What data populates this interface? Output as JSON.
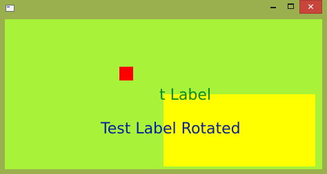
{
  "window": {
    "close_glyph": "✕",
    "colors": {
      "frame": "#9ab04f",
      "client_background": "#a8f23a",
      "close_button": "#c8453c"
    }
  },
  "canvas": {
    "square": {
      "color": "#ff0000"
    },
    "rectangle": {
      "color": "#ffff00"
    },
    "label_clipped": {
      "text": "t Label",
      "color": "#0b8a1e"
    },
    "label_rotated": {
      "text": "Test Label Rotated",
      "color": "#0a1f9e"
    }
  }
}
